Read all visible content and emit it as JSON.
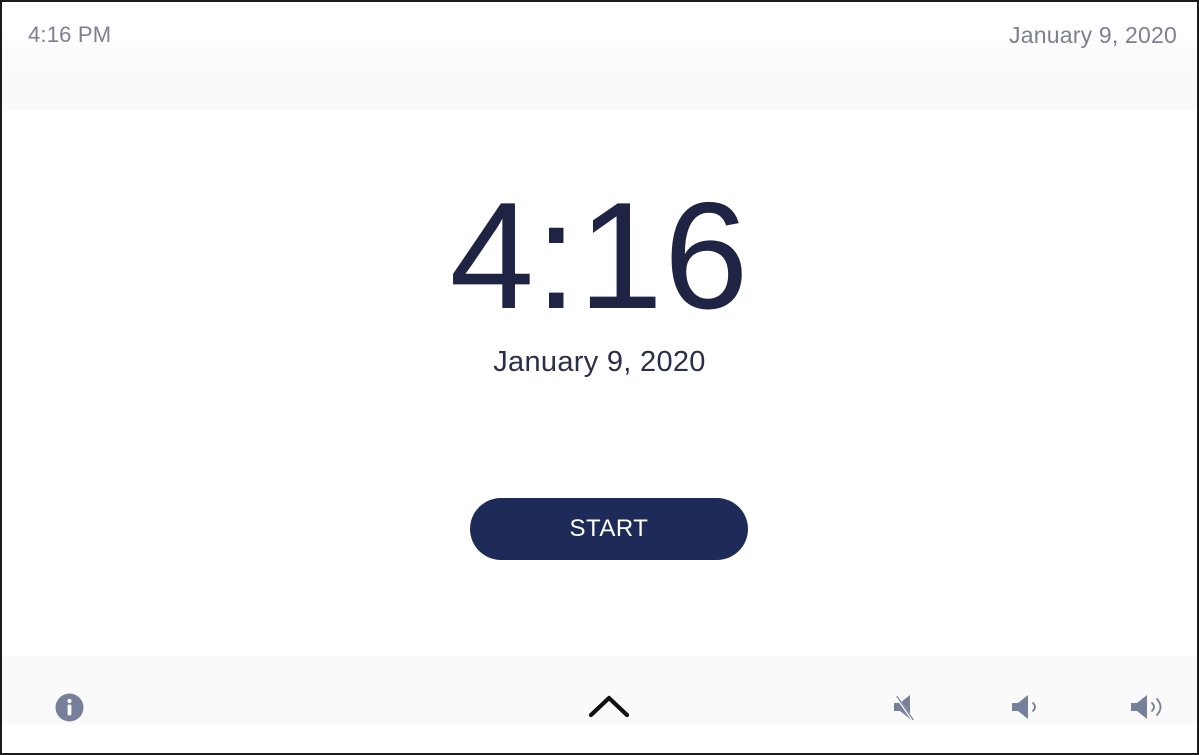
{
  "topbar": {
    "time": "4:16 PM",
    "date": "January 9, 2020"
  },
  "clock": {
    "time": "4:16",
    "date": "January 9, 2020"
  },
  "actions": {
    "start_label": "START"
  },
  "bottombar": {
    "icons": [
      "info-icon",
      "chevron-up-icon",
      "volume-mute-icon",
      "volume-low-icon",
      "volume-high-icon"
    ]
  },
  "colors": {
    "accent": "#1e2a58",
    "muted_text": "#7c8192",
    "icon": "#77809b",
    "clock_text": "#1f2444"
  }
}
